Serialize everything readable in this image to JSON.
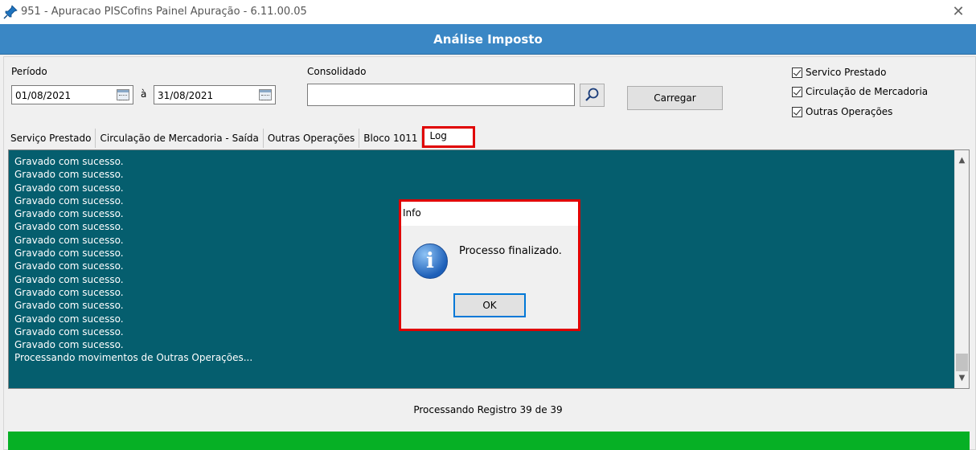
{
  "window": {
    "title": "951 - Apuracao PISCofins Painel Apuração - 6.11.00.05"
  },
  "header": {
    "title": "Análise Imposto"
  },
  "filters": {
    "periodo_label": "Período",
    "date_start": "01/08/2021",
    "separator": "à",
    "date_end": "31/08/2021",
    "consolidado_label": "Consolidado",
    "consolidado_value": "",
    "carregar_label": "Carregar"
  },
  "checkboxes": [
    {
      "label": "Servico Prestado",
      "checked": true
    },
    {
      "label": "Circulação de Mercadoria",
      "checked": true
    },
    {
      "label": "Outras Operações",
      "checked": true
    }
  ],
  "tabs": [
    {
      "label": "Serviço Prestado"
    },
    {
      "label": "Circulação de Mercadoria - Saída"
    },
    {
      "label": "Outras Operações"
    },
    {
      "label": "Bloco 1011"
    },
    {
      "label": "Log",
      "active": true
    }
  ],
  "log": {
    "lines": [
      "Gravado com sucesso.",
      "Gravado com sucesso.",
      "Gravado com sucesso.",
      "Gravado com sucesso.",
      "Gravado com sucesso.",
      "Gravado com sucesso.",
      "Gravado com sucesso.",
      "Gravado com sucesso.",
      "Gravado com sucesso.",
      "Gravado com sucesso.",
      "Gravado com sucesso.",
      "Gravado com sucesso.",
      "Gravado com sucesso.",
      "Gravado com sucesso.",
      "Gravado com sucesso.",
      "Processando movimentos de Outras Operações..."
    ]
  },
  "status": {
    "text": "Processando Registro 39 de 39",
    "progress": 1.0
  },
  "dialog": {
    "title": "Info",
    "message": "Processo finalizado.",
    "ok_label": "OK"
  },
  "colors": {
    "header": "#3a87c5",
    "log_bg": "#055e6e",
    "progress": "#06b025",
    "highlight": "#e00000"
  }
}
